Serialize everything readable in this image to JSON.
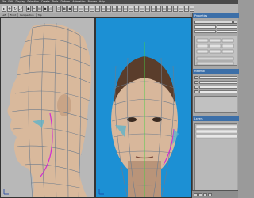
{
  "menubar": {
    "items": [
      "File",
      "Edit",
      "Display",
      "Selection",
      "Create",
      "Tools",
      "Deform",
      "Animation",
      "Render",
      "Help"
    ]
  },
  "toolbar": {
    "buttons": [
      "select-tool",
      "move-tool",
      "rotate-tool",
      "scale-tool",
      "weld-tool",
      "cut-tool",
      "extrude-tool",
      "bevel-tool",
      "smooth-tool",
      "snap-tool",
      "grid-tool",
      "camera-tool"
    ]
  },
  "tabs": [
    "Left",
    "Front",
    "Perspective",
    "Top"
  ],
  "viewports": {
    "left": {
      "name": "Left view"
    },
    "right": {
      "name": "Front view"
    }
  },
  "panel": {
    "title": "Properties",
    "section2_title": "Material",
    "section3_title": "Layers",
    "colors": {
      "accent": "#3c6fa8",
      "viewport_bg": "#1c90d4",
      "seam": "#d22bd2"
    }
  }
}
